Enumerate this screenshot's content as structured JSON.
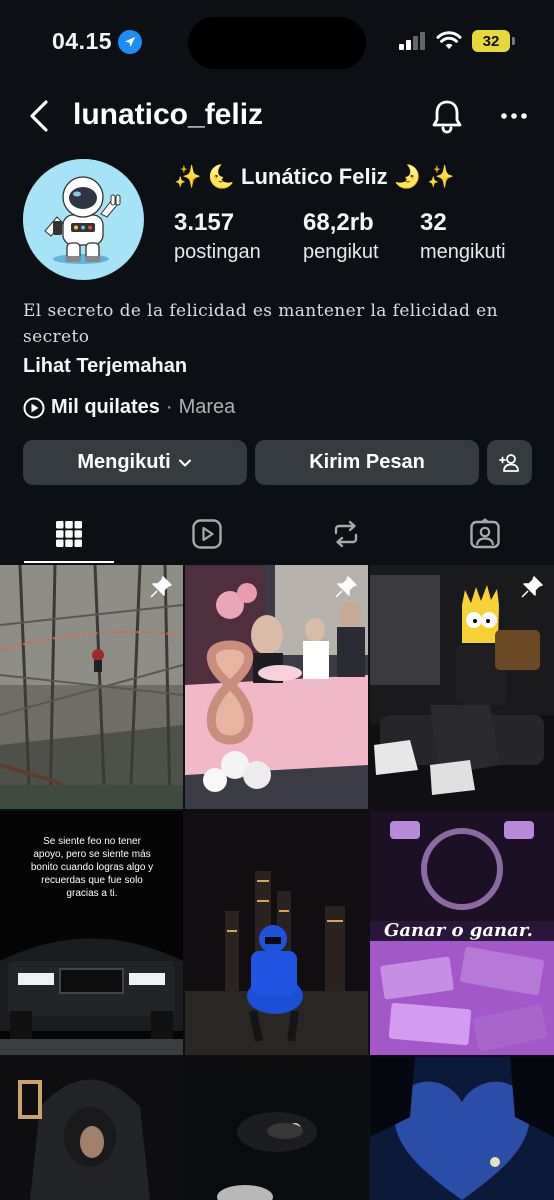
{
  "status": {
    "time": "04.15",
    "battery": "32"
  },
  "header": {
    "username": "lunatico_feliz"
  },
  "profile": {
    "display_name": "✨ 🌜 Lunático Feliz 🌛 ✨",
    "stats": [
      {
        "value": "3.157",
        "label": "postingan"
      },
      {
        "value": "68,2rb",
        "label": "pengikut"
      },
      {
        "value": "32",
        "label": "mengikuti"
      }
    ],
    "bio": "El secreto de la felicidad es mantener la felicidad en secreto",
    "translate_label": "Lihat Terjemahan",
    "music": {
      "title": "Mil quilates",
      "separator": "·",
      "artist": "Marea"
    }
  },
  "actions": {
    "follow_label": "Mengikuti",
    "message_label": "Kirim Pesan"
  },
  "tabs": [
    "grid-icon",
    "reels-icon",
    "repost-icon",
    "tagged-icon"
  ],
  "posts": {
    "quote_text": "Se siente feo no tener apoyo, pero se siente más bonito cuando logras algo y recuerdas que fue solo gracias a ti.",
    "ganar_text": "Ganar o ganar."
  },
  "colors": {
    "background": "#0c1014",
    "button": "#363b40",
    "battery": "#e8d73a",
    "location": "#1d8cf8"
  }
}
